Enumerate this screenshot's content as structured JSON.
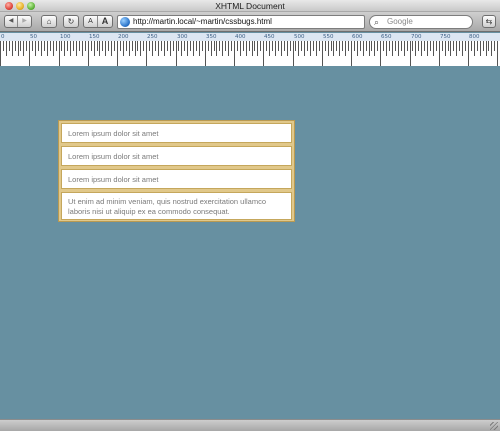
{
  "window": {
    "title": "XHTML Document"
  },
  "toolbar": {
    "back_icon": "back-arrow-icon",
    "forward_icon": "forward-arrow-icon",
    "home_icon": "home-icon",
    "reload_icon": "reload-icon",
    "font_smaller_label": "A",
    "font_larger_label": "A",
    "url": "http://martin.local/~martin/cssbugs.html",
    "search_placeholder": "Google"
  },
  "ruler": {
    "labels": [
      "0",
      "50",
      "100",
      "150",
      "200",
      "250",
      "300",
      "350",
      "400",
      "450",
      "500",
      "550",
      "600",
      "650",
      "700",
      "750",
      "800"
    ]
  },
  "content": {
    "items": [
      "Lorem ipsum dolor sit amet",
      "Lorem ipsum dolor sit amet",
      "Lorem ipsum dolor sit amet",
      "Ut enim ad minim veniam, quis nostrud exercitation ullamco laboris nisi ut aliquip ex ea commodo consequat."
    ]
  },
  "colors": {
    "page_background": "#6790a1",
    "box_border": "#e1c88a",
    "item_background": "#ffffff",
    "item_text": "#7a7a7a"
  }
}
